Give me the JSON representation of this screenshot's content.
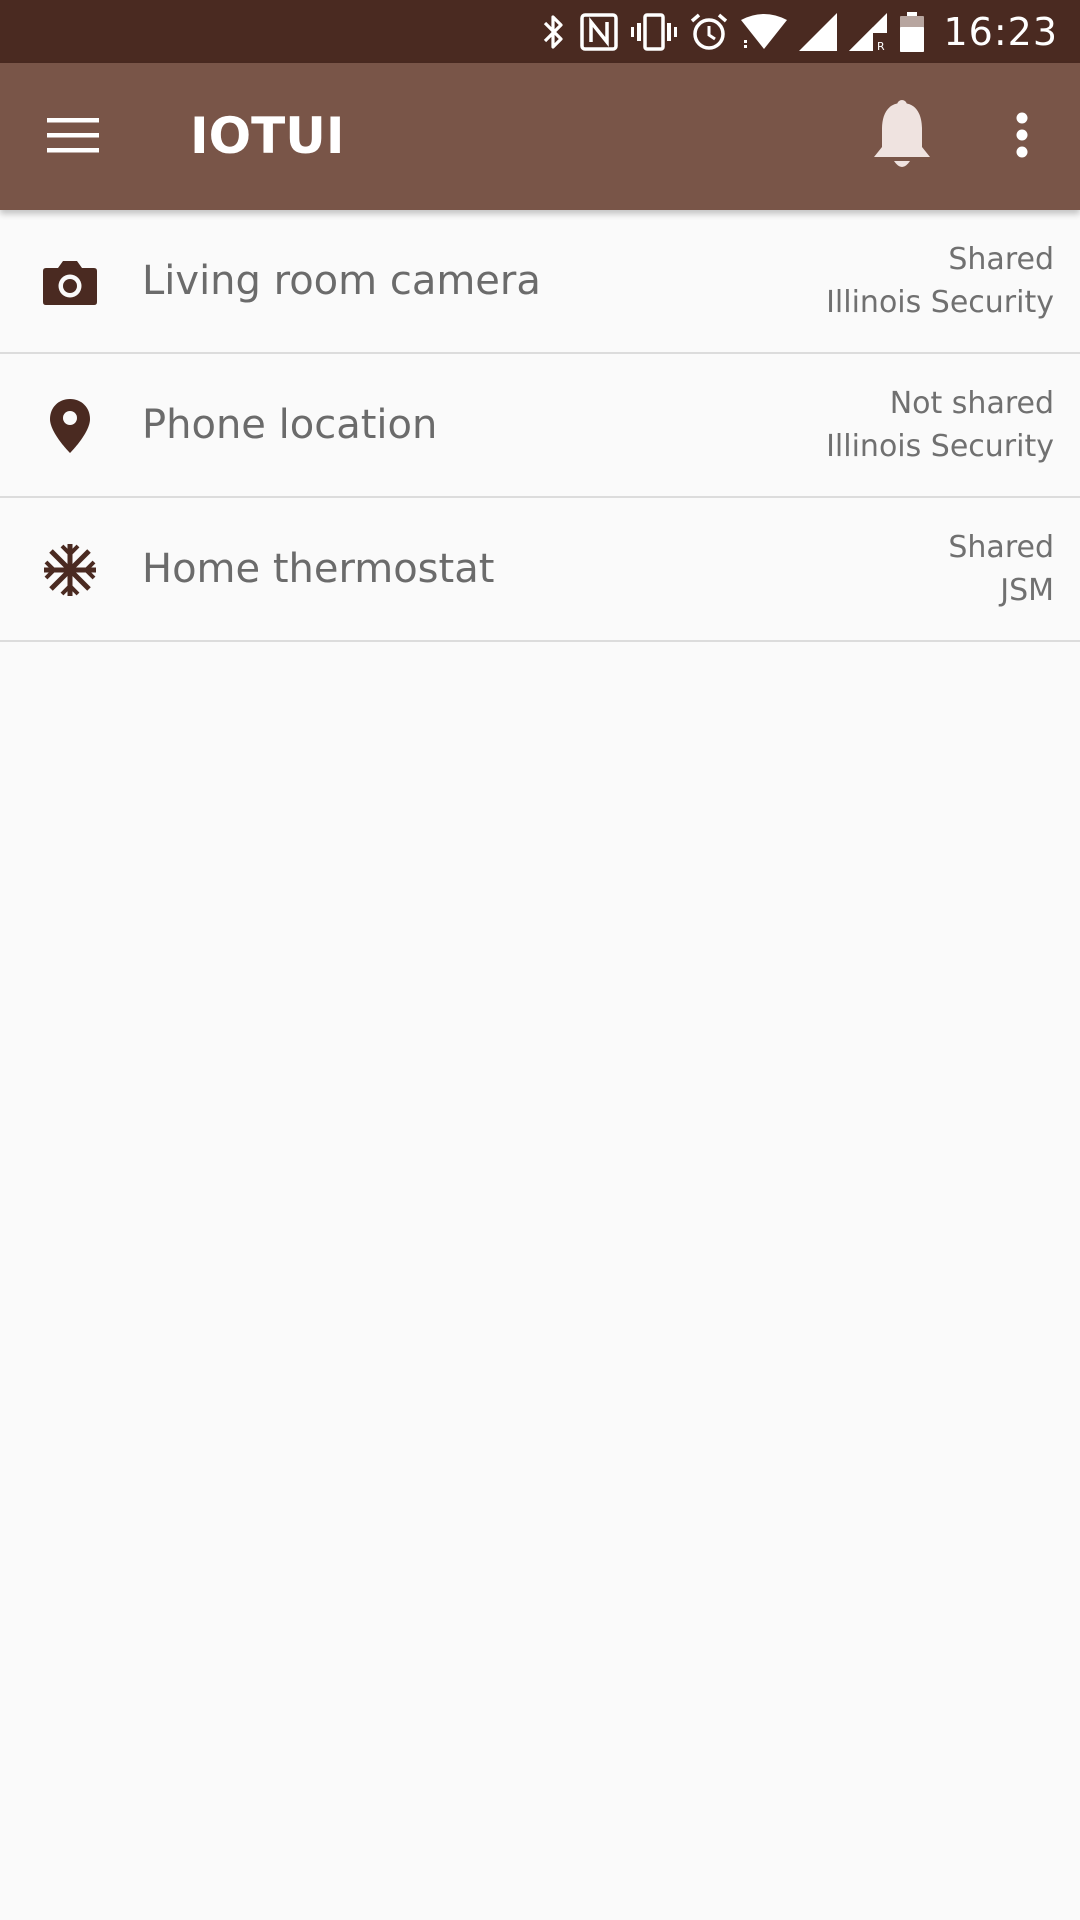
{
  "status_bar": {
    "time": "16:23",
    "icons": [
      "bluetooth-icon",
      "nfc-icon",
      "vibrate-icon",
      "alarm-icon",
      "wifi-icon",
      "cell-signal-icon",
      "cell-signal-roaming-icon",
      "battery-icon"
    ],
    "background": "#4A2A21"
  },
  "app_bar": {
    "title": "IOTUI",
    "menu_icon": "hamburger-menu-icon",
    "notification_icon": "bell-icon",
    "overflow_icon": "more-vert-icon",
    "background": "#795548",
    "bell_color": "#EFE3E0"
  },
  "devices": [
    {
      "icon": "camera-icon",
      "name": "Living room camera",
      "sharing": "Shared",
      "provider": "Illinois Security"
    },
    {
      "icon": "location-pin-icon",
      "name": "Phone location",
      "sharing": "Not shared",
      "provider": "Illinois Security"
    },
    {
      "icon": "snowflake-icon",
      "name": "Home thermostat",
      "sharing": "Shared",
      "provider": "JSM"
    }
  ],
  "colors": {
    "icon": "#4A2A21",
    "text_primary": "#6B6B6B",
    "text_secondary": "#707070",
    "divider": "#DCDCDC",
    "background": "#FAFAFA"
  }
}
